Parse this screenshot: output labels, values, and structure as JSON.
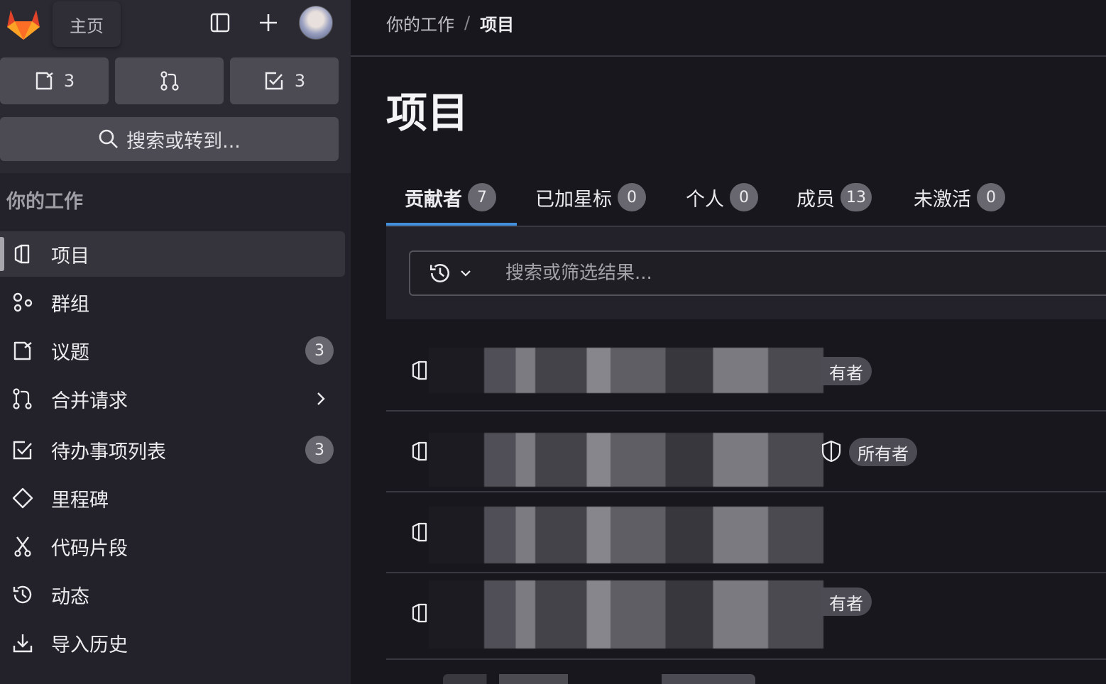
{
  "sidebar": {
    "home_label": "主页",
    "issues_count": "3",
    "todos_count": "3",
    "search_label": "搜索或转到...",
    "section_title": "你的工作",
    "items": [
      {
        "label": "项目",
        "icon": "project-icon"
      },
      {
        "label": "群组",
        "icon": "group-icon"
      },
      {
        "label": "议题",
        "icon": "issues-icon",
        "badge": "3"
      },
      {
        "label": "合并请求",
        "icon": "merge-request-icon"
      },
      {
        "label": "待办事项列表",
        "icon": "todo-icon",
        "badge": "3"
      },
      {
        "label": "里程碑",
        "icon": "milestone-icon"
      },
      {
        "label": "代码片段",
        "icon": "snippet-icon"
      },
      {
        "label": "动态",
        "icon": "history-icon"
      },
      {
        "label": "导入历史",
        "icon": "download-icon"
      }
    ]
  },
  "breadcrumb": {
    "parent": "你的工作",
    "separator": "/",
    "current": "项目"
  },
  "page": {
    "title": "项目"
  },
  "tabs": [
    {
      "label": "贡献者",
      "count": "7"
    },
    {
      "label": "已加星标",
      "count": "0"
    },
    {
      "label": "个人",
      "count": "0"
    },
    {
      "label": "成员",
      "count": "13"
    },
    {
      "label": "未激活",
      "count": "0"
    }
  ],
  "filter": {
    "placeholder": "搜索或筛选结果..."
  },
  "projects": [
    {
      "role": "有者"
    },
    {
      "role": "所有者"
    },
    {
      "role": ""
    },
    {
      "role": "有者"
    }
  ],
  "colors": {
    "accent": "#428fdc",
    "background": "#18171d",
    "sidebar": "#232129"
  }
}
